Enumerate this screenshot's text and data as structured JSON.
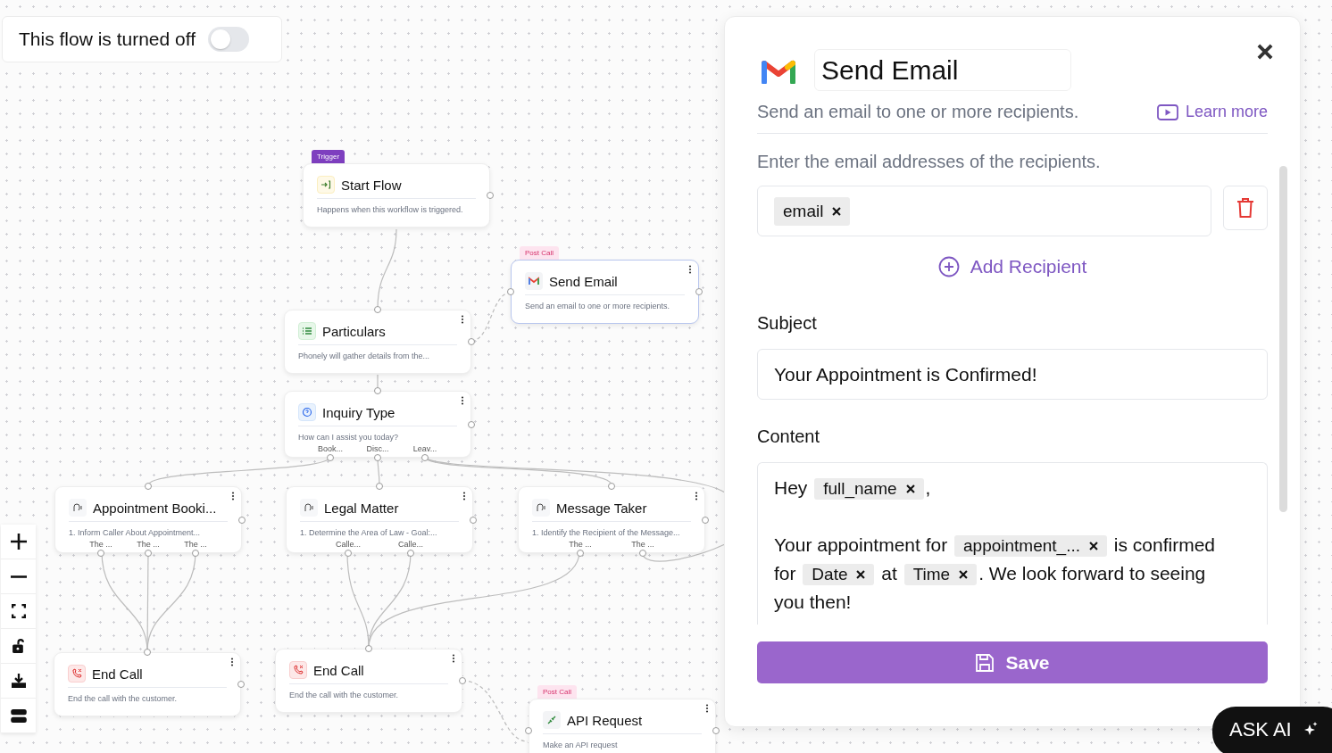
{
  "flow_toggle": {
    "label": "This flow is turned off",
    "on": false
  },
  "nodes": [
    {
      "badge": {
        "label": "Trigger",
        "kind": "trigger"
      },
      "kind": "start",
      "title": "Start Flow",
      "description": "Happens when this workflow is triggered.",
      "selected": false
    },
    {
      "badge": {
        "label": "Post Call",
        "kind": "post_call"
      },
      "kind": "email",
      "title": "Send Email",
      "description": "Send an email to one or more recipients.",
      "selected": true
    },
    {
      "kind": "gather",
      "title": "Particulars",
      "description": "Phonely will gather details from the...",
      "selected": false
    },
    {
      "kind": "question",
      "title": "Inquiry Type",
      "description": "How can I assist you today?",
      "outputs": [
        "Book...",
        "Disc...",
        "Leav..."
      ],
      "selected": false
    },
    {
      "kind": "agent",
      "title": "Appointment Booki...",
      "description": "1. Inform Caller About Appointment...",
      "outputs": [
        "The ...",
        "The ...",
        "The ..."
      ],
      "selected": false
    },
    {
      "kind": "agent",
      "title": "Legal Matter",
      "description": "1. Determine the Area of Law - Goal:...",
      "outputs": [
        "Calle...",
        "Calle..."
      ],
      "selected": false
    },
    {
      "kind": "agent",
      "title": "Message Taker",
      "description": "1. Identify the Recipient of the Message...",
      "outputs": [
        "The ...",
        "The ..."
      ],
      "selected": false
    },
    {
      "kind": "end_call",
      "title": "End Call",
      "description": "End the call with the customer.",
      "selected": false
    },
    {
      "kind": "end_call",
      "title": "End Call",
      "description": "End the call with the customer.",
      "selected": false
    },
    {
      "badge": {
        "label": "Post Call",
        "kind": "post_call"
      },
      "kind": "api",
      "title": "API Request",
      "description": "Make an API request",
      "selected": false
    }
  ],
  "panel": {
    "title": "Send Email",
    "subtitle": "Send an email to one or more recipients.",
    "learn_more": "Learn more",
    "recipients_label": "Enter the email addresses of the recipients.",
    "recipients": [
      "email"
    ],
    "add_recipient": "Add Recipient",
    "subject_label": "Subject",
    "subject": "Your Appointment is Confirmed!",
    "content_label": "Content",
    "content": [
      {
        "kind": "text",
        "text": "Hey "
      },
      {
        "kind": "chip",
        "text": "full_name"
      },
      {
        "kind": "text",
        "text": ","
      },
      {
        "kind": "break"
      },
      {
        "kind": "break"
      },
      {
        "kind": "text",
        "text": "Your appointment for "
      },
      {
        "kind": "chip",
        "text": "appointment_..."
      },
      {
        "kind": "text",
        "text": " is confirmed"
      },
      {
        "kind": "break"
      },
      {
        "kind": "text",
        "text": "for "
      },
      {
        "kind": "chip",
        "text": "Date"
      },
      {
        "kind": "text",
        "text": " at "
      },
      {
        "kind": "chip",
        "text": "Time"
      },
      {
        "kind": "text",
        "text": ". We look forward to seeing"
      },
      {
        "kind": "break"
      },
      {
        "kind": "text",
        "text": "you then!"
      }
    ],
    "save": "Save"
  },
  "ask_ai": "ASK AI"
}
